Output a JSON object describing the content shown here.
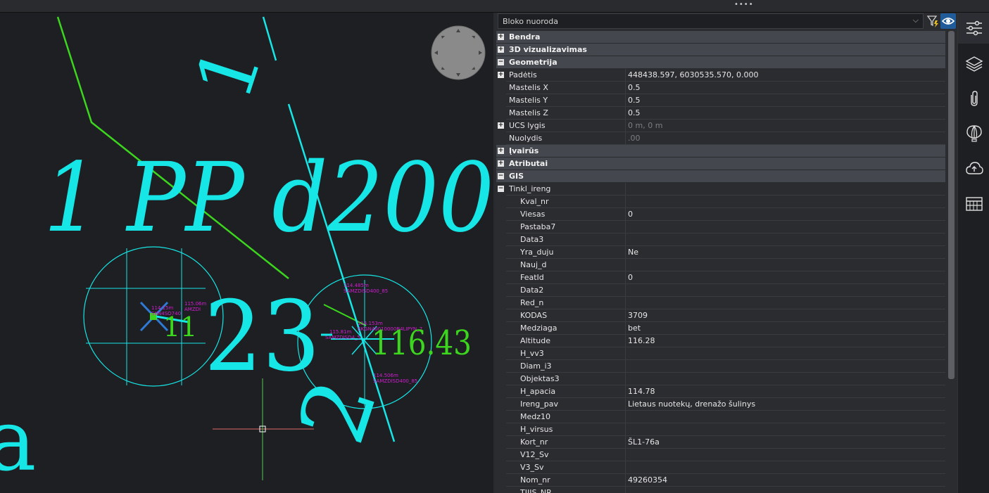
{
  "viewport": {
    "drawing_texts": {
      "large_1": "1",
      "pp": "1 PP d200",
      "n23": "23",
      "elev": "116.43",
      "rot_1": "1",
      "rot_2": "2",
      "left_a": "a",
      "small_11": "11",
      "lbl_a": "114.485m",
      "lbl_b": "SAMZDISD400_85",
      "lbl_c": "114.153m",
      "lbl_d": "SKGN40010000B4LIPYN_7",
      "lbl_e": "115.81m",
      "lbl_f": "SAMZDISD4_5",
      "lbl_g": "114.506m",
      "lbl_h": "SAMZDISD400_85",
      "lbl_i": "114.15m",
      "lbl_j": "SKN4SO740",
      "lbl_k": "115.06m",
      "lbl_l": "AMZDI"
    }
  },
  "panel": {
    "block_select": "Bloko nuoroda",
    "rows": [
      {
        "type": "cat",
        "exp": "+",
        "name": "Bendra"
      },
      {
        "type": "cat",
        "exp": "+",
        "name": "3D vizualizavimas"
      },
      {
        "type": "cat",
        "exp": "−",
        "name": "Geometrija"
      },
      {
        "type": "prop",
        "exp": "+",
        "name": "Padėtis",
        "value": "448438.597, 6030535.570, 0.000"
      },
      {
        "type": "prop",
        "name": "Mastelis X",
        "value": "0.5"
      },
      {
        "type": "prop",
        "name": "Mastelis Y",
        "value": "0.5"
      },
      {
        "type": "prop",
        "name": "Mastelis Z",
        "value": "0.5"
      },
      {
        "type": "prop",
        "exp": "+",
        "name": "UCS lygis",
        "value": "0 m, 0 m",
        "dim": true
      },
      {
        "type": "prop",
        "name": "Nuolydis",
        "value": ".00",
        "dim": true
      },
      {
        "type": "cat",
        "exp": "+",
        "name": "Įvairūs"
      },
      {
        "type": "cat",
        "exp": "+",
        "name": "Atributai"
      },
      {
        "type": "cat",
        "exp": "−",
        "name": "GIS"
      },
      {
        "type": "prop",
        "exp": "−",
        "name": "Tinkl_ireng",
        "value": ""
      },
      {
        "type": "sub",
        "name": "Kval_nr",
        "value": ""
      },
      {
        "type": "sub",
        "name": "Viesas",
        "value": "0"
      },
      {
        "type": "sub",
        "name": "Pastaba7",
        "value": ""
      },
      {
        "type": "sub",
        "name": "Data3",
        "value": ""
      },
      {
        "type": "sub",
        "name": "Yra_duju",
        "value": "Ne"
      },
      {
        "type": "sub",
        "name": "Nauj_d",
        "value": ""
      },
      {
        "type": "sub",
        "name": "FeatId",
        "value": "0"
      },
      {
        "type": "sub",
        "name": "Data2",
        "value": ""
      },
      {
        "type": "sub",
        "name": "Red_n",
        "value": ""
      },
      {
        "type": "sub",
        "name": "KODAS",
        "value": "3709"
      },
      {
        "type": "sub",
        "name": "Medziaga",
        "value": "bet"
      },
      {
        "type": "sub",
        "name": "Altitude",
        "value": "116.28"
      },
      {
        "type": "sub",
        "name": "H_vv3",
        "value": ""
      },
      {
        "type": "sub",
        "name": "Diam_i3",
        "value": ""
      },
      {
        "type": "sub",
        "name": "Objektas3",
        "value": ""
      },
      {
        "type": "sub",
        "name": "H_apacia",
        "value": "114.78"
      },
      {
        "type": "sub",
        "name": "Ireng_pav",
        "value": "Lietaus nuotekų, drenažo šulinys"
      },
      {
        "type": "sub",
        "name": "Medz10",
        "value": ""
      },
      {
        "type": "sub",
        "name": "H_virsus",
        "value": ""
      },
      {
        "type": "sub",
        "name": "Kort_nr",
        "value": "ŠL1-76a"
      },
      {
        "type": "sub",
        "name": "V12_Sv",
        "value": ""
      },
      {
        "type": "sub",
        "name": "V3_Sv",
        "value": ""
      },
      {
        "type": "sub",
        "name": "Nom_nr",
        "value": "49260354"
      },
      {
        "type": "sub",
        "name": "TIIIS_NR",
        "value": ""
      }
    ]
  },
  "rightbar": {
    "icons": [
      "properties-sliders-icon",
      "layers-icon",
      "attachment-icon",
      "hot-air-balloon-icon",
      "cloud-upload-icon",
      "library-icon"
    ]
  },
  "colors": {
    "cyan": "#16e6e6",
    "green": "#3cd61e",
    "magenta": "#d11ed1",
    "accent": "#1f5c99"
  }
}
